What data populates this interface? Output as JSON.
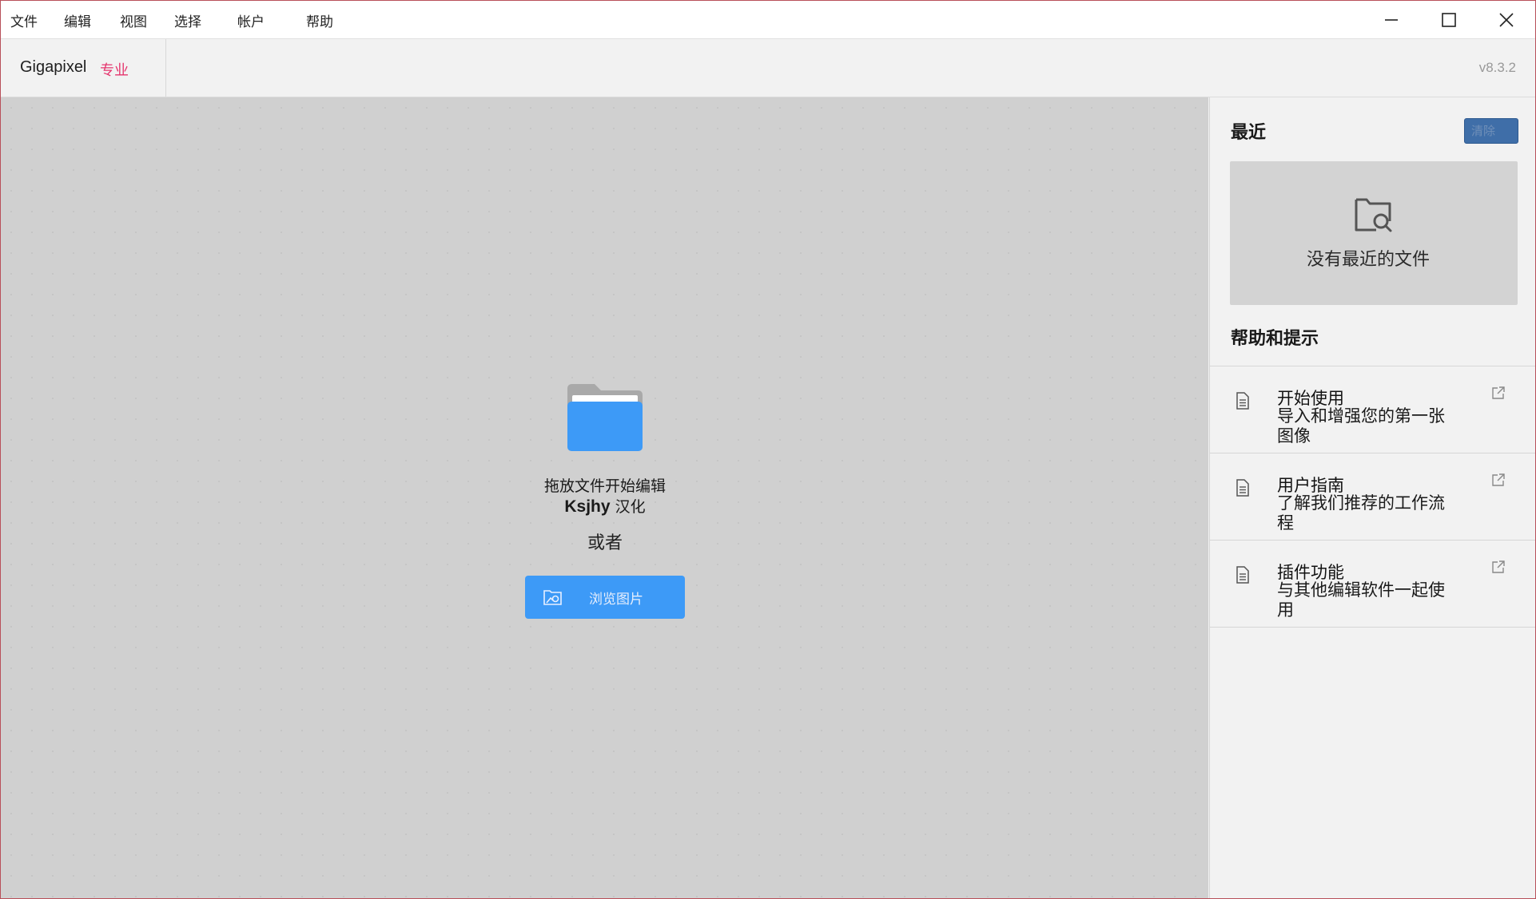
{
  "menu": {
    "items": [
      "文件",
      "编辑",
      "视图",
      "选择",
      "帐户",
      "帮助"
    ]
  },
  "window_controls": {
    "minimize": "minimize-icon",
    "maximize": "maximize-icon",
    "close": "close-icon"
  },
  "header": {
    "app_name": "Gigapixel",
    "edition": "专业",
    "version": "v8.3.2"
  },
  "dropzone": {
    "title": "拖放文件开始编辑",
    "credit_bold": "Ksjhy",
    "credit_rest": " 汉化",
    "or_text": "或者",
    "browse_label": "浏览图片",
    "folder_icon": "folder-icon",
    "browse_icon": "image-folder-icon"
  },
  "sidepanel": {
    "recent_heading": "最近",
    "clear_label": "清除",
    "empty_text": "没有最近的文件",
    "help_heading": "帮助和提示",
    "help_items": [
      {
        "title": "开始使用",
        "desc": "导入和增强您的第一张图像"
      },
      {
        "title": "用户指南",
        "desc": "了解我们推荐的工作流程"
      },
      {
        "title": "插件功能",
        "desc": "与其他编辑软件一起使用"
      }
    ]
  },
  "colors": {
    "accent_blue": "#3d9af7",
    "edition_pink": "#e5356d",
    "clear_button": "#3f6ea8",
    "dropzone_bg": "#d0d0d0",
    "panel_bg": "#f2f2f2"
  }
}
